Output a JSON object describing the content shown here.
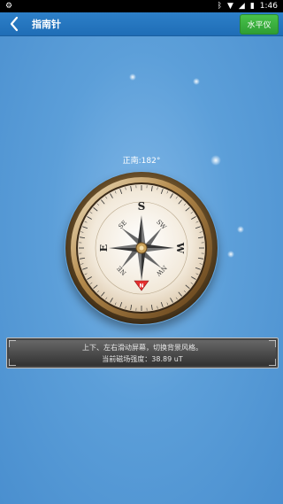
{
  "status_bar": {
    "left_icon": "settings-gear-icon",
    "right_icons": [
      "bluetooth-icon",
      "wifi-icon",
      "cellular-signal-icon",
      "battery-icon"
    ],
    "time": "1:46"
  },
  "app_bar": {
    "title": "指南针",
    "back_icon": "back-chevron-icon",
    "level_button_label": "水平仪",
    "level_button_color": "#3aa63e"
  },
  "compass": {
    "heading_label": "正南:182°",
    "cardinals": {
      "north": "N",
      "south": "S",
      "east": "E",
      "west": "W"
    },
    "intercardinals": {
      "ne": "NE",
      "se": "SE",
      "sw": "SW",
      "nw": "NW"
    },
    "north_marker_color": "#e52f2f"
  },
  "info_panel": {
    "line1": "上下、左右滑动屏幕，切换背景风格。",
    "line2": "当前磁场强度：38.89 uT"
  }
}
